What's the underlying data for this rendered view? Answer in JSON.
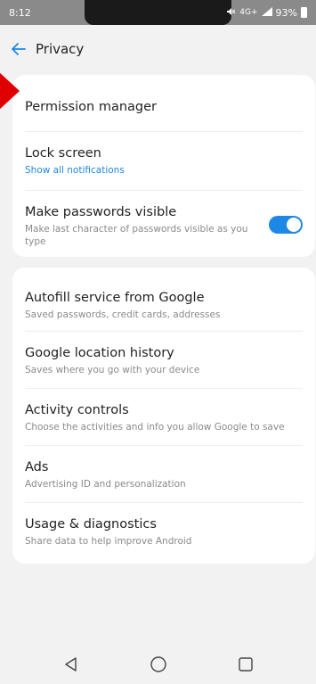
{
  "status": {
    "time": "8:12",
    "network": "4G+",
    "battery": "93%"
  },
  "header": {
    "title": "Privacy"
  },
  "section1": {
    "items": [
      {
        "title": "Permission manager",
        "subtitle": ""
      },
      {
        "title": "Lock screen",
        "subtitle": "Show all notifications"
      },
      {
        "title": "Make passwords visible",
        "subtitle": "Make last character of passwords visible as you type",
        "toggle": true
      }
    ]
  },
  "section2": {
    "items": [
      {
        "title": "Autofill service from Google",
        "subtitle": "Saved passwords, credit cards, addresses"
      },
      {
        "title": "Google location history",
        "subtitle": "Saves where you go with your device"
      },
      {
        "title": "Activity controls",
        "subtitle": "Choose the activities and info you allow Google to save"
      },
      {
        "title": "Ads",
        "subtitle": "Advertising ID and personalization"
      },
      {
        "title": "Usage & diagnostics",
        "subtitle": "Share data to help improve Android"
      }
    ]
  },
  "colors": {
    "accent": "#1e88e5",
    "pointer": "#e00000"
  },
  "icons": [
    "back-arrow-icon",
    "mute-icon",
    "signal-icon",
    "battery-icon",
    "nav-back-icon",
    "nav-home-icon",
    "nav-recents-icon",
    "pointer-arrow-icon"
  ]
}
